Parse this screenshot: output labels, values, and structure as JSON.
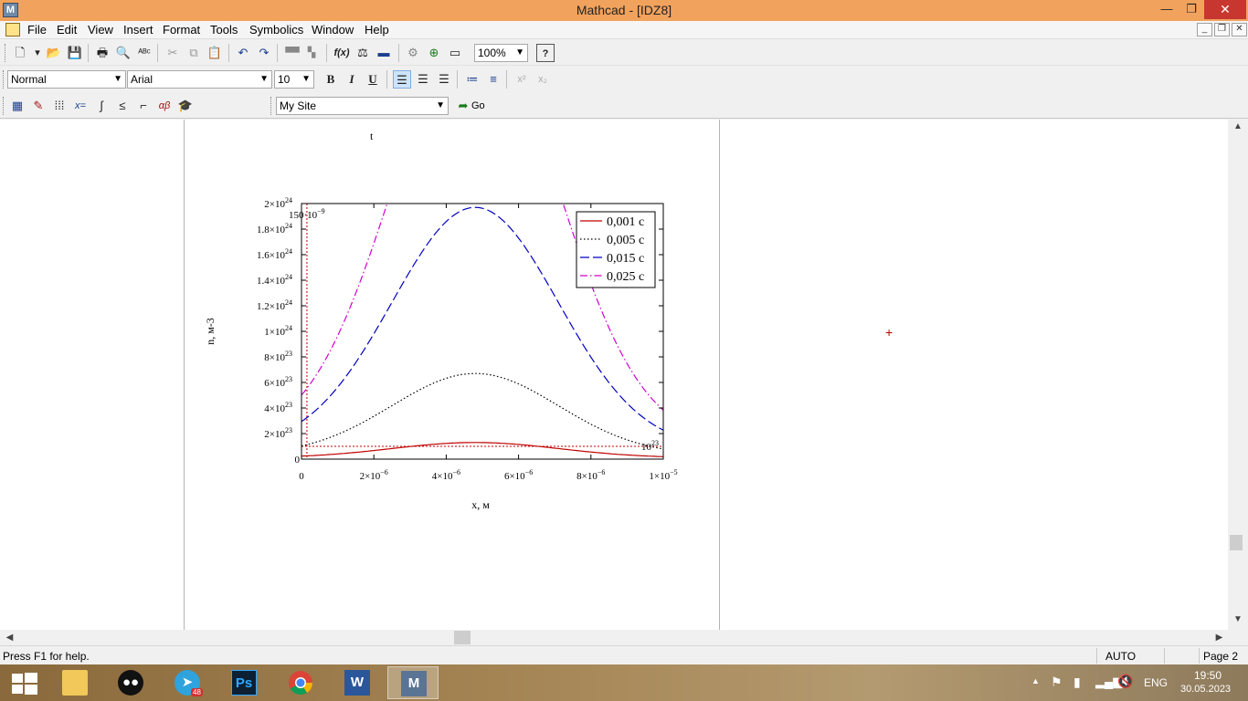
{
  "window": {
    "title": "Mathcad - [IDZ8]",
    "app_icon_letter": "M",
    "min_glyph": "—",
    "max_glyph": "❐",
    "close_glyph": "✕"
  },
  "menu": {
    "items": [
      "File",
      "Edit",
      "View",
      "Insert",
      "Format",
      "Tools",
      "Symbolics",
      "Window",
      "Help"
    ],
    "mdi_min": "_",
    "mdi_restore": "❐",
    "mdi_close": "✕"
  },
  "toolbar_standard": {
    "zoom": "100%",
    "help_glyph": "?"
  },
  "toolbar_format": {
    "style": "Normal",
    "font": "Arial",
    "size": "10",
    "bold": "B",
    "italic": "I",
    "underline": "U",
    "superscript": "x²",
    "subscript": "x₂"
  },
  "toolbar_math": {
    "site": "My Site",
    "go_label": "Go",
    "eval_label": "x=",
    "greek_label": "αβ"
  },
  "worksheet": {
    "previous_plot_axis_label": "t",
    "cursor_glyph": "+"
  },
  "chart_data": {
    "type": "line",
    "xlabel": "x, м",
    "ylabel": "n, м-3",
    "xlim": [
      0,
      1e-05
    ],
    "ylim": [
      0,
      2e+24
    ],
    "x_ticks": [
      {
        "value": 0,
        "label": "0",
        "exp": ""
      },
      {
        "value": 2e-06,
        "label": "2×10",
        "exp": "−6"
      },
      {
        "value": 4e-06,
        "label": "4×10",
        "exp": "−6"
      },
      {
        "value": 6e-06,
        "label": "6×10",
        "exp": "−6"
      },
      {
        "value": 8e-06,
        "label": "8×10",
        "exp": "−6"
      },
      {
        "value": 1e-05,
        "label": "1×10",
        "exp": "−5"
      }
    ],
    "y_ticks": [
      {
        "value": 0,
        "label": "0",
        "exp": ""
      },
      {
        "value": 2e+23,
        "label": "2×10",
        "exp": "23"
      },
      {
        "value": 4e+23,
        "label": "4×10",
        "exp": "23"
      },
      {
        "value": 6e+23,
        "label": "6×10",
        "exp": "23"
      },
      {
        "value": 8e+23,
        "label": "8×10",
        "exp": "23"
      },
      {
        "value": 1e+24,
        "label": "1×10",
        "exp": "24"
      },
      {
        "value": 1.2e+24,
        "label": "1.2×10",
        "exp": "24"
      },
      {
        "value": 1.4e+24,
        "label": "1.4×10",
        "exp": "24"
      },
      {
        "value": 1.6e+24,
        "label": "1.6×10",
        "exp": "24"
      },
      {
        "value": 1.8e+24,
        "label": "1.8×10",
        "exp": "24"
      },
      {
        "value": 2e+24,
        "label": "2×10",
        "exp": "24"
      }
    ],
    "marker_x": {
      "value": 1.5e-07,
      "label": "150·10",
      "exp": "−9"
    },
    "marker_y": {
      "value": 1e+23,
      "label": "10",
      "exp": "23"
    },
    "legend_position": "top-right",
    "series": [
      {
        "name": "0,001 с",
        "color": "#c00000",
        "style": "solid",
        "x_center": 4.8e-06,
        "peak": 1.3e+23,
        "base": 1e+22
      },
      {
        "name": "0,005 с",
        "color": "#000000",
        "style": "dotted",
        "x_center": 4.8e-06,
        "peak": 6.7e+23,
        "base": 3e+22
      },
      {
        "name": "0,015 с",
        "color": "#0000c0",
        "style": "dashed",
        "x_center": 4.8e-06,
        "peak": 1.97e+24,
        "base": 8e+22
      },
      {
        "name": "0,025 с",
        "color": "#d000d0",
        "style": "dashdot",
        "x_center": 4.8e-06,
        "peak": 3.4e+24,
        "base": 1.3e+23
      }
    ]
  },
  "status": {
    "help_text": "Press F1 for help.",
    "mode": "AUTO",
    "page": "Page 2"
  },
  "taskbar": {
    "telegram_badge": "48",
    "photoshop_label": "Ps",
    "word_label": "W",
    "mathcad_label": "M",
    "language": "ENG",
    "time": "19:50",
    "date": "30.05.2023"
  }
}
